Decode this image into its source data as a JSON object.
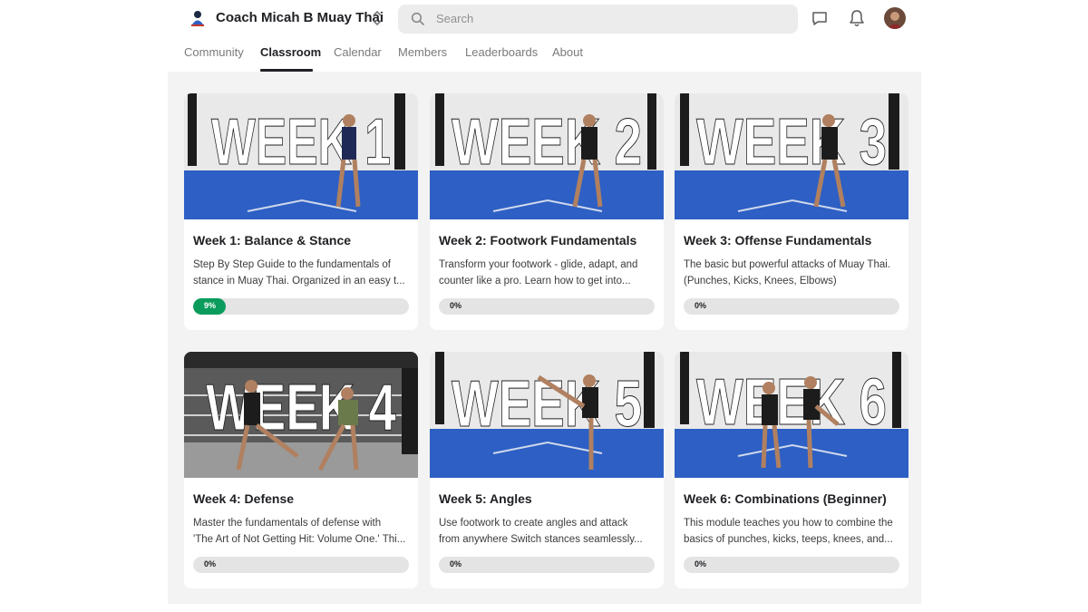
{
  "header": {
    "group_name": "Coach Micah B Muay Thai",
    "search_placeholder": "Search",
    "icons": {
      "logo": "group-logo-icon",
      "switcher": "chevron-up-down-icon",
      "search": "search-icon",
      "chat": "chat-icon",
      "bell": "bell-icon",
      "avatar": "user-avatar"
    }
  },
  "tabs": [
    {
      "label": "Community",
      "active": false
    },
    {
      "label": "Classroom",
      "active": true
    },
    {
      "label": "Calendar",
      "active": false
    },
    {
      "label": "Members",
      "active": false
    },
    {
      "label": "Leaderboards",
      "active": false
    },
    {
      "label": "About",
      "active": false
    }
  ],
  "colors": {
    "progress_fill": "#0a9c5c",
    "mat_blue": "#2d5fc4",
    "page_bg": "#f3f3f3"
  },
  "courses": [
    {
      "thumb_text": "WEEK 1",
      "title": "Week 1: Balance & Stance",
      "desc_line1": "Step By Step Guide to the fundamentals of",
      "desc_line2": "stance in Muay Thai. Organized in an easy t...",
      "progress_label": "9%",
      "progress": 0.09
    },
    {
      "thumb_text": "WEEK 2",
      "title": "Week 2: Footwork Fundamentals",
      "desc_line1": "Transform your footwork - glide, adapt, and",
      "desc_line2": "counter like a pro. Learn how to get into...",
      "progress_label": "0%",
      "progress": 0
    },
    {
      "thumb_text": "WEEK 3",
      "title": "Week 3: Offense Fundamentals",
      "desc_line1": "The basic but powerful attacks of Muay Thai.",
      "desc_line2": "(Punches, Kicks, Knees, Elbows)",
      "progress_label": "0%",
      "progress": 0
    },
    {
      "thumb_text": "WEEK 4",
      "title": "Week 4: Defense",
      "desc_line1": "Master the fundamentals of defense with",
      "desc_line2": "'The Art of Not Getting Hit: Volume One.' Thi...",
      "progress_label": "0%",
      "progress": 0
    },
    {
      "thumb_text": "WEEK 5",
      "title": "Week 5: Angles",
      "desc_line1": "Use footwork to create angles and attack",
      "desc_line2": "from anywhere Switch stances seamlessly...",
      "progress_label": "0%",
      "progress": 0
    },
    {
      "thumb_text": "WEEK 6",
      "title": "Week 6: Combinations (Beginner)",
      "desc_line1": "This module teaches you how to combine the",
      "desc_line2": "basics of punches, kicks, teeps, knees, and...",
      "progress_label": "0%",
      "progress": 0
    }
  ]
}
